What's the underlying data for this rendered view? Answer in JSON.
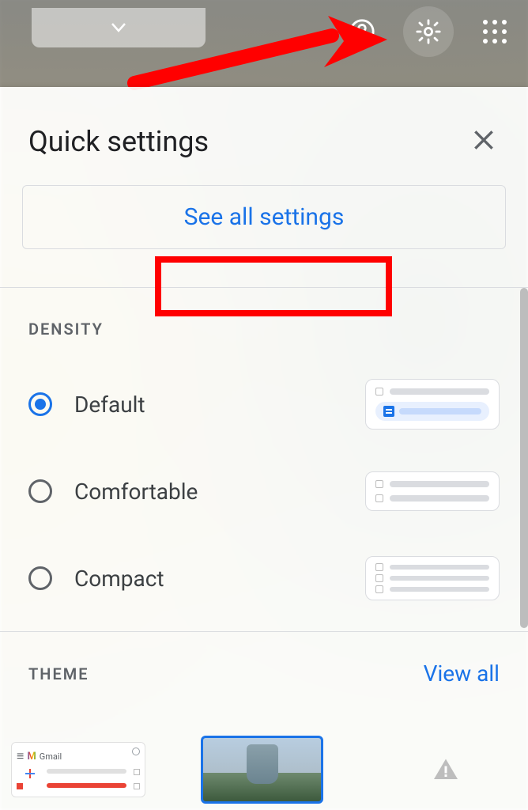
{
  "topbar": {
    "help_icon": "help-circle-icon",
    "settings_icon": "gear-icon",
    "apps_icon": "apps-grid-icon"
  },
  "panel": {
    "title": "Quick settings",
    "close_icon": "close-icon",
    "see_all": "See all settings"
  },
  "density": {
    "label": "DENSITY",
    "options": [
      {
        "label": "Default",
        "selected": true
      },
      {
        "label": "Comfortable",
        "selected": false
      },
      {
        "label": "Compact",
        "selected": false
      }
    ]
  },
  "theme": {
    "label": "THEME",
    "view_all": "View all",
    "gmail_label": "Gmail"
  }
}
